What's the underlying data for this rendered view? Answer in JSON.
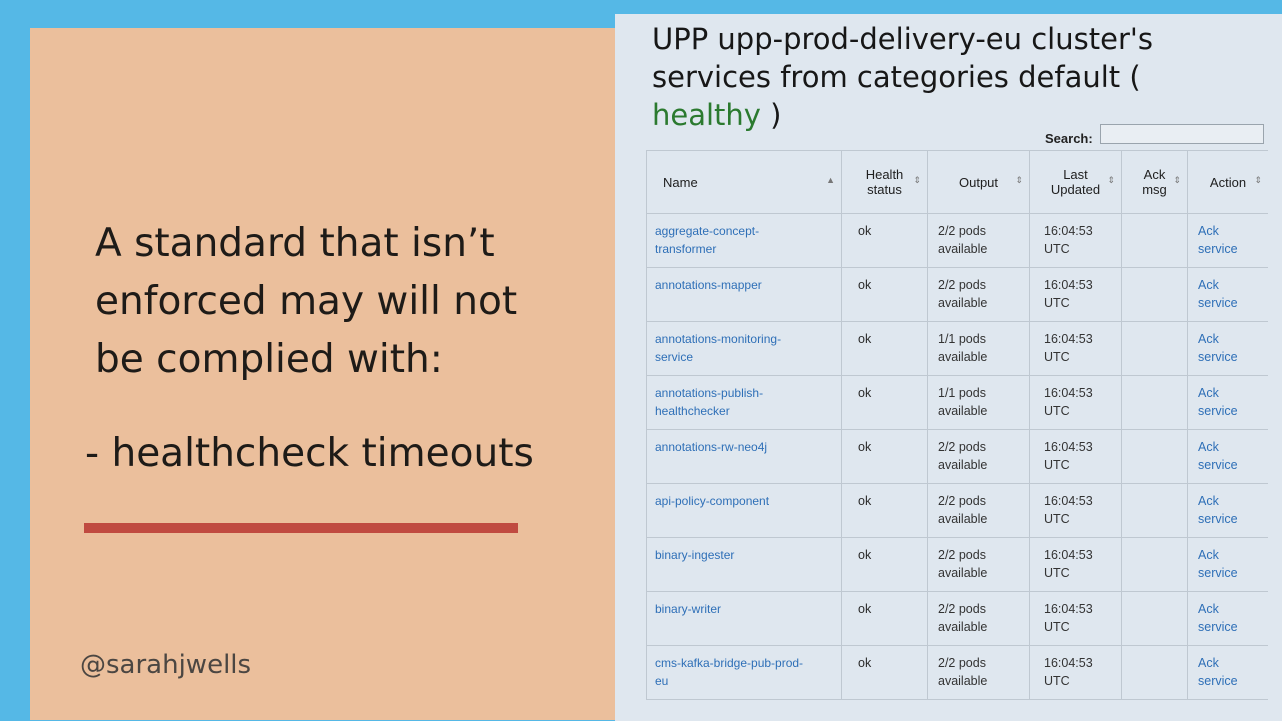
{
  "slide": {
    "headline_lines": [
      "A standard that isn’t",
      "enforced may will not",
      "be complied with:"
    ],
    "bullet": "- healthcheck timeouts",
    "handle": "@sarahjwells"
  },
  "panel": {
    "title_prefix": "UPP upp-prod-delivery-eu cluster's services from categories default (",
    "title_status": "healthy",
    "title_suffix": " )",
    "search_label": "Search:",
    "search_value": ""
  },
  "table": {
    "columns": {
      "name": "Name",
      "health": [
        "Health",
        "status"
      ],
      "output": "Output",
      "updated": [
        "Last",
        "Updated"
      ],
      "ack": [
        "Ack",
        "msg"
      ],
      "action": "Action"
    },
    "rows": [
      {
        "name": [
          "aggregate-concept-",
          "transformer"
        ],
        "health": "ok",
        "output": [
          "2/2 pods",
          "available"
        ],
        "updated": [
          "16:04:53",
          "UTC"
        ],
        "ack": "",
        "action": [
          "Ack",
          "service"
        ]
      },
      {
        "name": [
          "annotations-mapper",
          ""
        ],
        "health": "ok",
        "output": [
          "2/2 pods",
          "available"
        ],
        "updated": [
          "16:04:53",
          "UTC"
        ],
        "ack": "",
        "action": [
          "Ack",
          "service"
        ]
      },
      {
        "name": [
          "annotations-monitoring-",
          "service"
        ],
        "health": "ok",
        "output": [
          "1/1 pods",
          "available"
        ],
        "updated": [
          "16:04:53",
          "UTC"
        ],
        "ack": "",
        "action": [
          "Ack",
          "service"
        ]
      },
      {
        "name": [
          "annotations-publish-",
          "healthchecker"
        ],
        "health": "ok",
        "output": [
          "1/1 pods",
          "available"
        ],
        "updated": [
          "16:04:53",
          "UTC"
        ],
        "ack": "",
        "action": [
          "Ack",
          "service"
        ]
      },
      {
        "name": [
          "annotations-rw-neo4j",
          ""
        ],
        "health": "ok",
        "output": [
          "2/2 pods",
          "available"
        ],
        "updated": [
          "16:04:53",
          "UTC"
        ],
        "ack": "",
        "action": [
          "Ack",
          "service"
        ]
      },
      {
        "name": [
          "api-policy-component",
          ""
        ],
        "health": "ok",
        "output": [
          "2/2 pods",
          "available"
        ],
        "updated": [
          "16:04:53",
          "UTC"
        ],
        "ack": "",
        "action": [
          "Ack",
          "service"
        ]
      },
      {
        "name": [
          "binary-ingester",
          ""
        ],
        "health": "ok",
        "output": [
          "2/2 pods",
          "available"
        ],
        "updated": [
          "16:04:53",
          "UTC"
        ],
        "ack": "",
        "action": [
          "Ack",
          "service"
        ]
      },
      {
        "name": [
          "binary-writer",
          ""
        ],
        "health": "ok",
        "output": [
          "2/2 pods",
          "available"
        ],
        "updated": [
          "16:04:53",
          "UTC"
        ],
        "ack": "",
        "action": [
          "Ack",
          "service"
        ]
      },
      {
        "name": [
          "cms-kafka-bridge-pub-prod-",
          "eu"
        ],
        "health": "ok",
        "output": [
          "2/2 pods",
          "available"
        ],
        "updated": [
          "16:04:53",
          "UTC"
        ],
        "ack": "",
        "action": [
          "Ack",
          "service"
        ]
      }
    ]
  },
  "colors": {
    "background": "#55b8e6",
    "slide_panel": "#ebbf9c",
    "accent_rule": "#c04a40",
    "healthy": "#2b7a2f",
    "link": "#2e6fb7"
  }
}
